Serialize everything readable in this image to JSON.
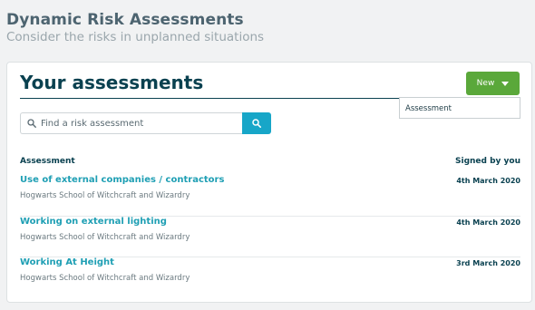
{
  "header": {
    "title": "Dynamic Risk Assessments",
    "subtitle": "Consider the risks in unplanned situations"
  },
  "card": {
    "title": "Your assessments",
    "new_button_label": "New",
    "dropdown_items": [
      "Assessment"
    ],
    "search": {
      "placeholder": "Find a risk assessment",
      "value": ""
    },
    "columns": {
      "assessment": "Assessment",
      "signed": "Signed by you"
    },
    "rows": [
      {
        "title": "Use of external companies / contractors",
        "organisation": "Hogwarts School of Witchcraft and Wizardry",
        "signed": "4th March 2020"
      },
      {
        "title": "Working on external lighting",
        "organisation": "Hogwarts School of Witchcraft and Wizardry",
        "signed": "4th March 2020"
      },
      {
        "title": "Working At Height",
        "organisation": "Hogwarts School of Witchcraft and Wizardry",
        "signed": "3rd March 2020"
      }
    ]
  },
  "icons": {
    "search_input": "search-icon",
    "search_button": "search-icon",
    "new_button": "caret-down-icon"
  },
  "colors": {
    "primary": "#0a4150",
    "link": "#1f9fb4",
    "new_button": "#5aa83a",
    "search_button": "#17a6c8"
  }
}
